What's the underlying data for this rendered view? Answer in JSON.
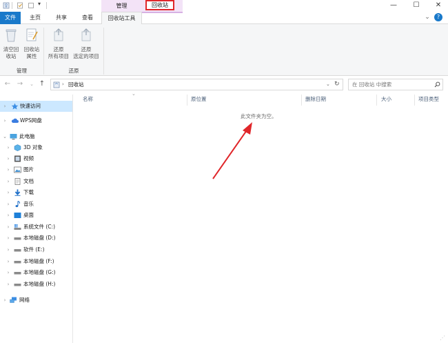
{
  "titlebar": {
    "context_group_manage": "管理",
    "context_group_recycle": "回收站",
    "window_controls": {
      "minimize": "—",
      "maximize": "☐",
      "close": "✕"
    }
  },
  "tabs": {
    "file": "文件",
    "home": "主页",
    "share": "共享",
    "view": "查看",
    "recycle_tools": "回收站工具"
  },
  "ribbon": {
    "empty_recycle": [
      "清空回",
      "收站"
    ],
    "recycle_props": [
      "回收站",
      "属性"
    ],
    "restore_all": [
      "还原",
      "所有项目"
    ],
    "restore_selected": [
      "还原",
      "选定的项目"
    ],
    "group_manage": "管理",
    "group_restore": "还原"
  },
  "address": {
    "path": "回收站",
    "search_placeholder": "在 回收站 中搜索"
  },
  "nav": {
    "quick_access": "快速访问",
    "wps": "WPS网盘",
    "this_pc": "此电脑",
    "objects3d": "3D 对象",
    "videos": "视频",
    "pictures": "图片",
    "documents": "文档",
    "downloads": "下载",
    "music": "音乐",
    "desktop": "桌面",
    "drive_c": "系统文件 (C:)",
    "drive_d": "本地磁盘 (D:)",
    "drive_e": "软件 (E:)",
    "drive_f": "本地磁盘 (F:)",
    "drive_g": "本地磁盘 (G:)",
    "drive_h": "本地磁盘 (H:)",
    "network": "网络"
  },
  "columns": {
    "name": "名称",
    "original_location": "原位置",
    "date_deleted": "删除日期",
    "size": "大小",
    "item_type": "项目类型"
  },
  "content": {
    "empty_message": "此文件夹为空。"
  },
  "colors": {
    "file_tab": "#1979ca",
    "context_tab": "#f3e3f7",
    "highlight_box": "#e0262a",
    "arrow": "#e0262a",
    "selection": "#cce8ff"
  }
}
